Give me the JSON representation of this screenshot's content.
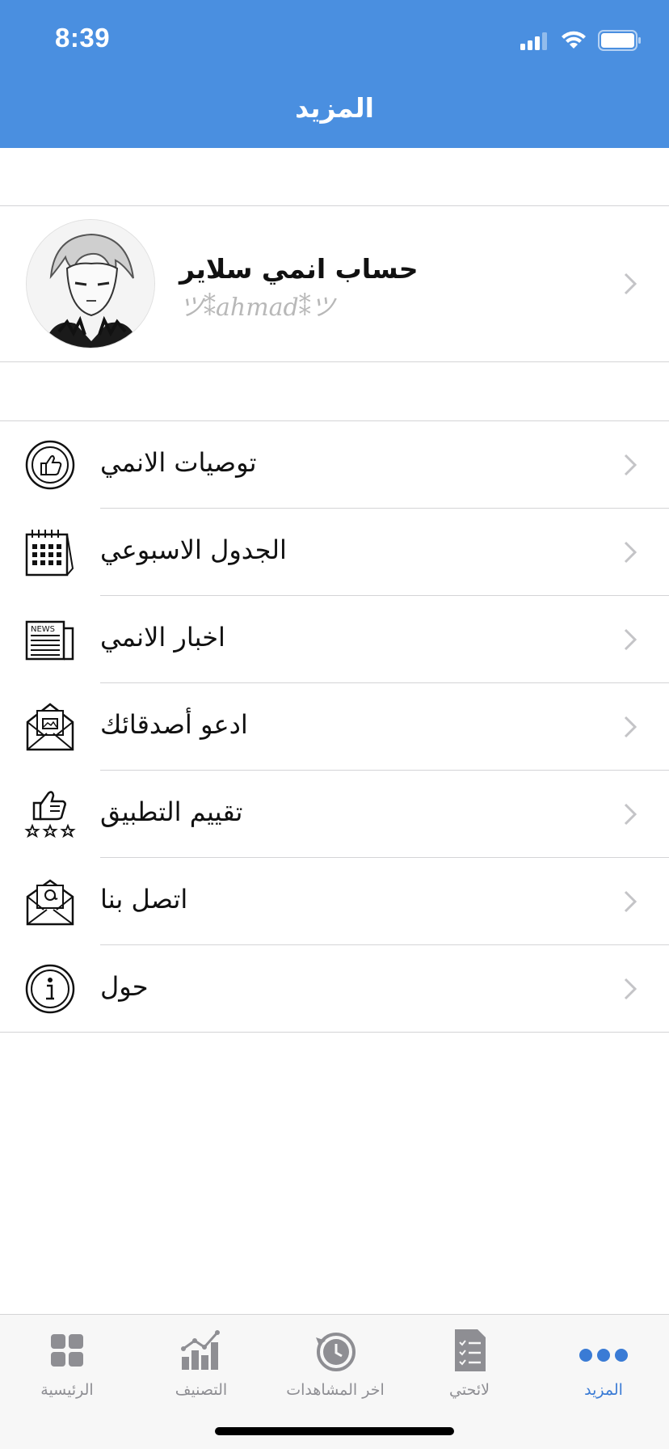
{
  "status": {
    "time": "8:39"
  },
  "nav": {
    "title": "المزيد"
  },
  "profile": {
    "name": "حساب انمي سلاير",
    "subtitle": "ツ⁑ahmad⁑ツ"
  },
  "menu": [
    {
      "label": "توصيات الانمي",
      "icon": "thumbs-up-badge-icon"
    },
    {
      "label": "الجدول الاسبوعي",
      "icon": "calendar-icon"
    },
    {
      "label": "اخبار الانمي",
      "icon": "newspaper-icon"
    },
    {
      "label": "ادعو أصدقائك",
      "icon": "invitation-envelope-icon"
    },
    {
      "label": "تقييم التطبيق",
      "icon": "rate-app-icon"
    },
    {
      "label": "اتصل بنا",
      "icon": "email-icon"
    },
    {
      "label": "حول",
      "icon": "info-icon"
    }
  ],
  "tabs": [
    {
      "label": "الرئيسية",
      "icon": "grid-icon"
    },
    {
      "label": "التصنيف",
      "icon": "chart-icon"
    },
    {
      "label": "اخر المشاهدات",
      "icon": "history-icon"
    },
    {
      "label": "لائحتي",
      "icon": "list-icon"
    },
    {
      "label": "المزيد",
      "icon": "more-dots-icon",
      "active": true
    }
  ],
  "colors": {
    "header": "#4a8fe0",
    "active_tab": "#3a7bd5",
    "inactive_tab": "#8e8e93"
  }
}
